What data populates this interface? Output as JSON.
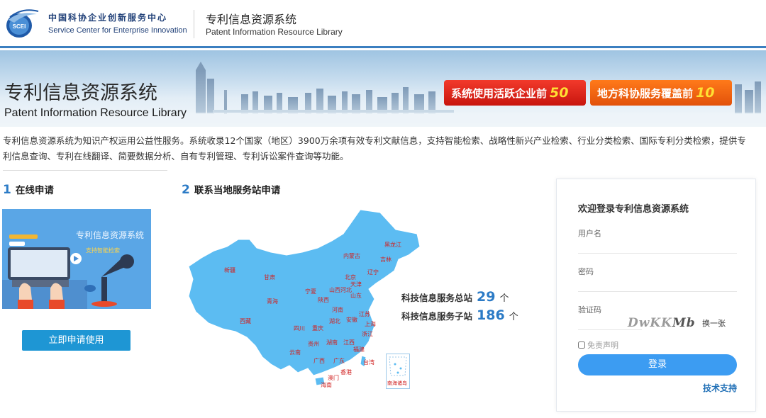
{
  "header": {
    "org_name_cn": "中国科协企业创新服务中心",
    "org_name_en": "Service Center for Enterprise Innovation",
    "logo_text": "SCEI",
    "system_name_cn": "专利信息资源系统",
    "system_name_en": "Patent Information Resource Library"
  },
  "banner": {
    "title_cn": "专利信息资源系统",
    "title_en": "Patent Information Resource Library",
    "badge_active_text": "系统使用活跃企业前",
    "badge_active_num": "50",
    "badge_coverage_text": "地方科协服务覆盖前",
    "badge_coverage_num": "10"
  },
  "intro": {
    "text": "专利信息资源系统为知识产权运用公益性服务。系统收录12个国家（地区）3900万余项有效专利文献信息，支持智能检索、战略性新兴产业检索、行业分类检索、国际专利分类检索，提供专利信息查询、专利在线翻译、简要数据分析、自有专利管理、专利诉讼案件查询等功能。"
  },
  "online_apply": {
    "step_num": "1",
    "label": "在线申请",
    "illustration_title": "专利信息资源系统",
    "illustration_subtitle": "支持智能检索",
    "button_label": "立即申请使用"
  },
  "local_station": {
    "step_num": "2",
    "label": "联系当地服务站申请",
    "total_station_label": "科技信息服务总站",
    "total_station_count": "29",
    "sub_station_label": "科技信息服务子站",
    "sub_station_count": "186",
    "unit": "个",
    "provinces": [
      "黑龙江",
      "吉林",
      "辽宁",
      "内蒙古",
      "北京",
      "天津",
      "河北",
      "山西",
      "山东",
      "宁夏",
      "甘肃",
      "新疆",
      "青海",
      "陕西",
      "河南",
      "江苏",
      "安徽",
      "上海",
      "浙江",
      "西藏",
      "四川",
      "重庆",
      "湖北",
      "湖南",
      "贵州",
      "江西",
      "云南",
      "福建",
      "广西",
      "广东",
      "台湾",
      "香港",
      "澳门",
      "海南"
    ],
    "inset_label": "南海诸岛"
  },
  "login": {
    "title": "欢迎登录专利信息资源系统",
    "username_label": "用户名",
    "password_label": "密码",
    "captcha_label": "验证码",
    "captcha_text_light": "DwKK",
    "captcha_text_dark": "Mb",
    "refresh_label": "换一张",
    "disclaimer_label": "免责声明",
    "submit_label": "登录",
    "support_label": "技术支持"
  },
  "colors": {
    "accent_blue": "#2c7bc6",
    "button_blue": "#1e96d4",
    "login_button": "#3c9cf2",
    "map_fill": "#5cbcf2",
    "badge_red": "#d81e14",
    "badge_orange": "#f06a14"
  }
}
